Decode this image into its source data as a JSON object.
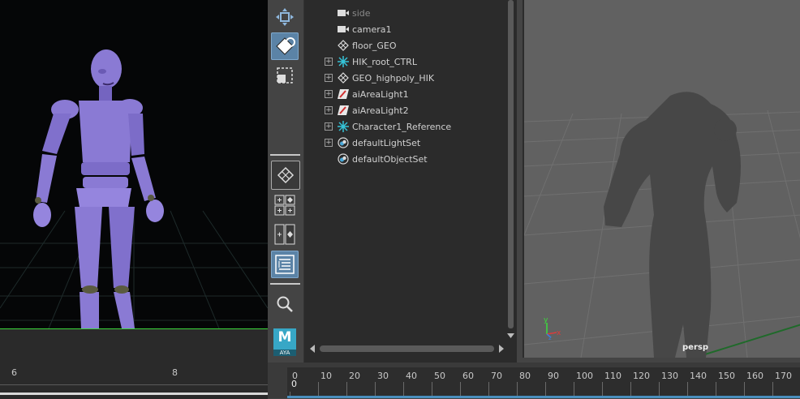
{
  "outliner": {
    "items": [
      {
        "label": "side",
        "icon": "camera-icon",
        "expandable": false,
        "dim": true
      },
      {
        "label": "camera1",
        "icon": "camera-icon",
        "expandable": false,
        "dim": false
      },
      {
        "label": "floor_GEO",
        "icon": "mesh-icon",
        "expandable": false,
        "dim": false
      },
      {
        "label": "HIK_root_CTRL",
        "icon": "joint-icon",
        "expandable": true,
        "dim": false
      },
      {
        "label": "GEO_highpoly_HIK",
        "icon": "mesh-icon",
        "expandable": true,
        "dim": false
      },
      {
        "label": "aiAreaLight1",
        "icon": "area-light-icon",
        "expandable": true,
        "dim": false
      },
      {
        "label": "aiAreaLight2",
        "icon": "area-light-icon",
        "expandable": true,
        "dim": false
      },
      {
        "label": "Character1_Reference",
        "icon": "joint-icon",
        "expandable": true,
        "dim": false
      },
      {
        "label": "defaultLightSet",
        "icon": "set-icon",
        "expandable": true,
        "dim": false
      },
      {
        "label": "defaultObjectSet",
        "icon": "set-icon",
        "expandable": false,
        "dim": false
      }
    ]
  },
  "toolbar": {
    "logo_text": "AYA",
    "logo_letter": "M"
  },
  "viewport": {
    "camera_label": "persp",
    "axis_y": "y",
    "axis_x": "x",
    "axis_z": "z"
  },
  "left_ruler": {
    "labels": [
      "6",
      "8"
    ]
  },
  "timeline": {
    "ticks": [
      "0",
      "10",
      "20",
      "30",
      "40",
      "50",
      "60",
      "70",
      "80",
      "90",
      "100",
      "110",
      "120",
      "130",
      "140",
      "150",
      "160",
      "170"
    ],
    "current_frame": "0"
  },
  "colors": {
    "accent": "#5b83a6",
    "character": "#8a7ad4",
    "grid_green": "#3bd83b"
  }
}
